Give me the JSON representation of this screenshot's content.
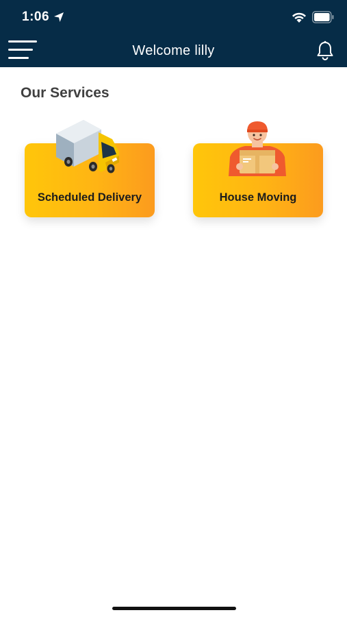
{
  "status_bar": {
    "time": "1:06"
  },
  "app_bar": {
    "title": "Welcome lilly"
  },
  "main": {
    "section_title": "Our Services",
    "services": [
      {
        "label": "Scheduled Delivery",
        "icon": "truck-icon"
      },
      {
        "label": "House Moving",
        "icon": "mover-icon"
      }
    ]
  },
  "colors": {
    "header": "#062c47",
    "card_gradient_start": "#ffc60a",
    "card_gradient_end": "#fc9b1e",
    "title_text": "#404040"
  }
}
